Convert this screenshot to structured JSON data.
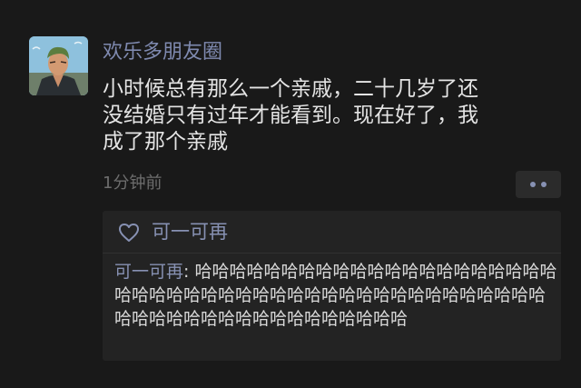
{
  "post": {
    "username": "欢乐多朋友圈",
    "text": "小时候总有那么一个亲戚，二十几岁了还\n没结婚只有过年才能看到。现在好了，我\n成了那个亲戚",
    "timestamp": "1分钟前"
  },
  "interactions": {
    "likes": [
      "可一可再"
    ],
    "comments": [
      {
        "author": "可一可再",
        "separator": ": ",
        "text": "哈哈哈哈哈哈哈哈哈哈哈哈哈哈哈哈哈哈哈哈哈哈哈哈哈哈哈哈哈哈哈哈哈哈哈哈哈哈哈哈哈哈哈哈哈哈哈哈哈哈哈哈哈哈哈哈哈哈哈哈哈哈哈"
      }
    ]
  },
  "icons": {
    "like": "heart-outline-icon",
    "more": "more-dots-icon",
    "avatar": "avatar-image"
  },
  "colors": {
    "background": "#191919",
    "name_link": "#7f8ab0",
    "body_text": "#e4e4e4",
    "muted_text": "#6d6d6d",
    "panel": "#232323"
  }
}
